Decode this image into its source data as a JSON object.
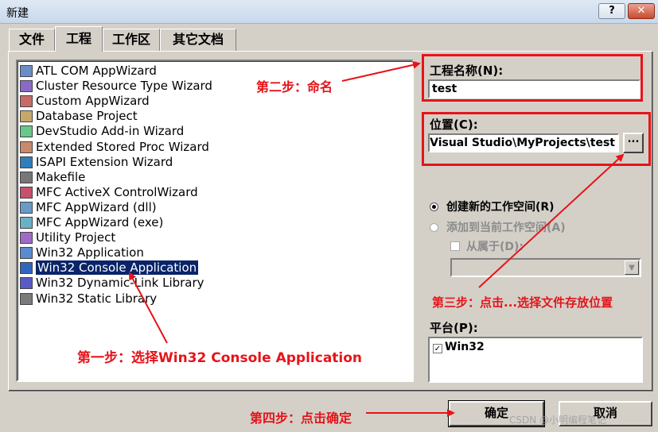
{
  "window": {
    "title": "新建",
    "help_label": "?",
    "close_label": "✕"
  },
  "tabs": [
    {
      "label": "文件",
      "active": false
    },
    {
      "label": "工程",
      "active": true
    },
    {
      "label": "工作区",
      "active": false
    },
    {
      "label": "其它文档",
      "active": false
    }
  ],
  "project_types": [
    {
      "label": "ATL COM AppWizard",
      "icon": "atl-com-icon",
      "selected": false
    },
    {
      "label": "Cluster Resource Type Wizard",
      "icon": "cluster-icon",
      "selected": false
    },
    {
      "label": "Custom AppWizard",
      "icon": "custom-wizard-icon",
      "selected": false
    },
    {
      "label": "Database Project",
      "icon": "database-icon",
      "selected": false
    },
    {
      "label": "DevStudio Add-in Wizard",
      "icon": "addin-icon",
      "selected": false
    },
    {
      "label": "Extended Stored Proc Wizard",
      "icon": "stored-proc-icon",
      "selected": false
    },
    {
      "label": "ISAPI Extension Wizard",
      "icon": "globe-icon",
      "selected": false
    },
    {
      "label": "Makefile",
      "icon": "makefile-icon",
      "selected": false
    },
    {
      "label": "MFC ActiveX ControlWizard",
      "icon": "activex-icon",
      "selected": false
    },
    {
      "label": "MFC AppWizard (dll)",
      "icon": "mfc-dll-icon",
      "selected": false
    },
    {
      "label": "MFC AppWizard (exe)",
      "icon": "mfc-exe-icon",
      "selected": false
    },
    {
      "label": "Utility Project",
      "icon": "utility-icon",
      "selected": false
    },
    {
      "label": "Win32 Application",
      "icon": "win32-app-icon",
      "selected": false
    },
    {
      "label": "Win32 Console Application",
      "icon": "console-icon",
      "selected": true
    },
    {
      "label": "Win32 Dynamic-Link Library",
      "icon": "dll-icon",
      "selected": false
    },
    {
      "label": "Win32 Static Library",
      "icon": "static-lib-icon",
      "selected": false
    }
  ],
  "project_name": {
    "label": "工程名称(N):",
    "value": "test"
  },
  "location": {
    "label": "位置(C):",
    "value": "oft Visual Studio\\MyProjects\\test",
    "browse_label": "..."
  },
  "workspace": {
    "create_new": "创建新的工作空间(R)",
    "add_current": "添加到当前工作空间(A)",
    "dependency": "从属于(D):"
  },
  "platform": {
    "label": "平台(P):",
    "items": [
      "Win32"
    ]
  },
  "buttons": {
    "ok": "确定",
    "cancel": "取消"
  },
  "annotations": {
    "step1": "第一步：选择Win32 Console Application",
    "step2": "第二步：命名",
    "step3": "第三步：点击...选择文件存放位置",
    "step4": "第四步：点击确定"
  },
  "watermark": "CSDN @小明编程笔记",
  "colors": {
    "annotation_red": "#e5141a",
    "selection_blue": "#0a246a",
    "dialog_gray": "#d4d0c8"
  }
}
